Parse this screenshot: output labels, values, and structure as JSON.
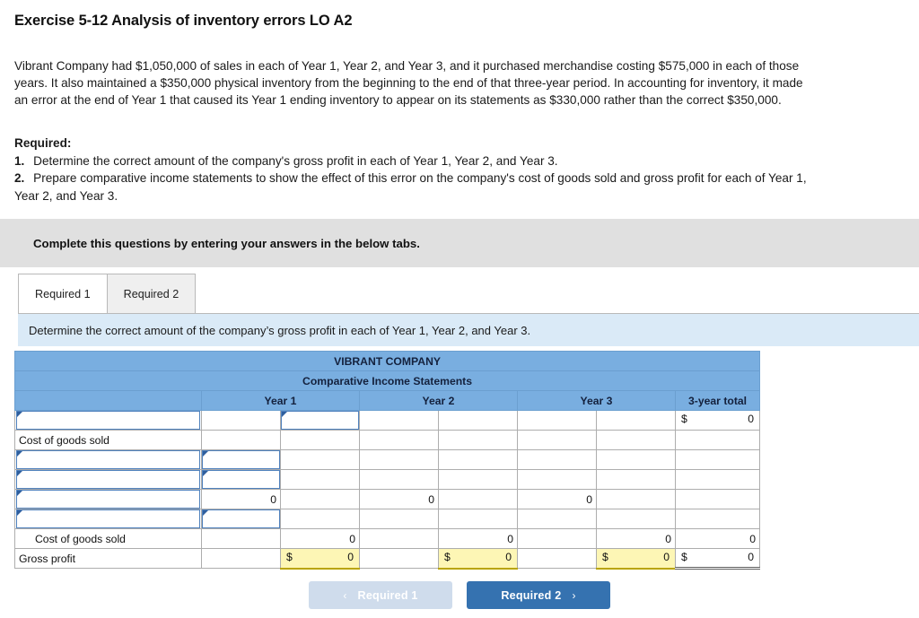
{
  "title": "Exercise 5-12 Analysis of inventory errors LO A2",
  "problem": "Vibrant Company had $1,050,000 of sales in each of Year 1, Year 2, and Year 3, and it purchased merchandise costing $575,000 in each of those years. It also maintained a $350,000 physical inventory from the beginning to the end of that three-year period. In accounting for inventory, it made an error at the end of Year 1 that caused its Year 1 ending inventory to appear on its statements as $330,000 rather than the correct $350,000.",
  "required": {
    "heading": "Required:",
    "item1_num": "1.",
    "item1": "Determine the correct amount of the company's gross profit in each of Year 1, Year 2, and Year 3.",
    "item2_num": "2.",
    "item2": "Prepare comparative income statements to show the effect of this error on the company's cost of goods sold and gross profit for each of Year 1, Year 2, and Year 3."
  },
  "instruction_bar": {
    "text": "Complete this questions by entering your answers in the below tabs."
  },
  "tabs": [
    {
      "label": "Required 1",
      "active": true
    },
    {
      "label": "Required 2",
      "active": false
    }
  ],
  "sub_instruction": "Determine the correct amount of the company’s gross profit in each of Year 1, Year 2, and Year 3.",
  "sheet": {
    "company_title": "VIBRANT COMPANY",
    "statement_title": "Comparative Income Statements",
    "column_headers": [
      "",
      "Year 1",
      "Year 2",
      "Year 3",
      "3-year total"
    ],
    "rows": [
      {
        "label": "",
        "label_input": true,
        "cells": [
          {
            "type": "input"
          },
          {
            "type": "blank"
          },
          {
            "type": "blank"
          },
          {
            "type": "blank"
          },
          {
            "type": "blank"
          },
          {
            "type": "blank"
          },
          {
            "type": "money",
            "dollar": "$",
            "value": "0"
          }
        ]
      },
      {
        "label": "Cost of goods sold",
        "label_input": false,
        "cells": [
          {
            "type": "blank"
          },
          {
            "type": "blank"
          },
          {
            "type": "blank"
          },
          {
            "type": "blank"
          },
          {
            "type": "blank"
          },
          {
            "type": "blank"
          },
          {
            "type": "blank"
          }
        ]
      },
      {
        "label": "",
        "label_input": true,
        "cells": [
          {
            "type": "input"
          },
          {
            "type": "blank"
          },
          {
            "type": "blank"
          },
          {
            "type": "blank"
          },
          {
            "type": "blank"
          },
          {
            "type": "blank"
          },
          {
            "type": "blank"
          }
        ]
      },
      {
        "label": "",
        "label_input": true,
        "cells": [
          {
            "type": "input"
          },
          {
            "type": "blank"
          },
          {
            "type": "blank"
          },
          {
            "type": "blank"
          },
          {
            "type": "blank"
          },
          {
            "type": "blank"
          },
          {
            "type": "blank"
          }
        ]
      },
      {
        "label": "",
        "label_input": true,
        "cells": [
          {
            "type": "total",
            "value": "0"
          },
          {
            "type": "blank"
          },
          {
            "type": "total",
            "value": "0"
          },
          {
            "type": "blank"
          },
          {
            "type": "total",
            "value": "0"
          },
          {
            "type": "blank"
          },
          {
            "type": "blank"
          }
        ]
      },
      {
        "label": "",
        "label_input": true,
        "cells": [
          {
            "type": "input"
          },
          {
            "type": "blank"
          },
          {
            "type": "blank"
          },
          {
            "type": "blank"
          },
          {
            "type": "blank"
          },
          {
            "type": "blank"
          },
          {
            "type": "blank"
          }
        ]
      },
      {
        "label": "Cost of goods sold",
        "label_input": false,
        "label_indent": true,
        "cells": [
          {
            "type": "blank"
          },
          {
            "type": "total",
            "value": "0"
          },
          {
            "type": "blank"
          },
          {
            "type": "total",
            "value": "0"
          },
          {
            "type": "blank"
          },
          {
            "type": "total",
            "value": "0"
          },
          {
            "type": "total",
            "value": "0"
          }
        ]
      },
      {
        "label": "Gross profit",
        "label_input": false,
        "cells": [
          {
            "type": "blank"
          },
          {
            "type": "money-hl",
            "dollar": "$",
            "value": "0"
          },
          {
            "type": "blank"
          },
          {
            "type": "money-hl",
            "dollar": "$",
            "value": "0"
          },
          {
            "type": "blank"
          },
          {
            "type": "money-hl",
            "dollar": "$",
            "value": "0"
          },
          {
            "type": "money-end",
            "dollar": "$",
            "value": "0"
          }
        ]
      }
    ]
  },
  "nav": {
    "prev_label": "Required 1",
    "prev_chevron": "‹",
    "next_label": "Required 2",
    "next_chevron": "›"
  },
  "colors": {
    "header_blue": "#79aee0",
    "band_blue": "#daeaf7",
    "instruction_grey": "#e0e0e0",
    "input_border": "#4f81bd",
    "highlight_yellow": "#fdf6b5",
    "button_blue": "#3572b0",
    "button_disabled": "#cfdcec"
  }
}
